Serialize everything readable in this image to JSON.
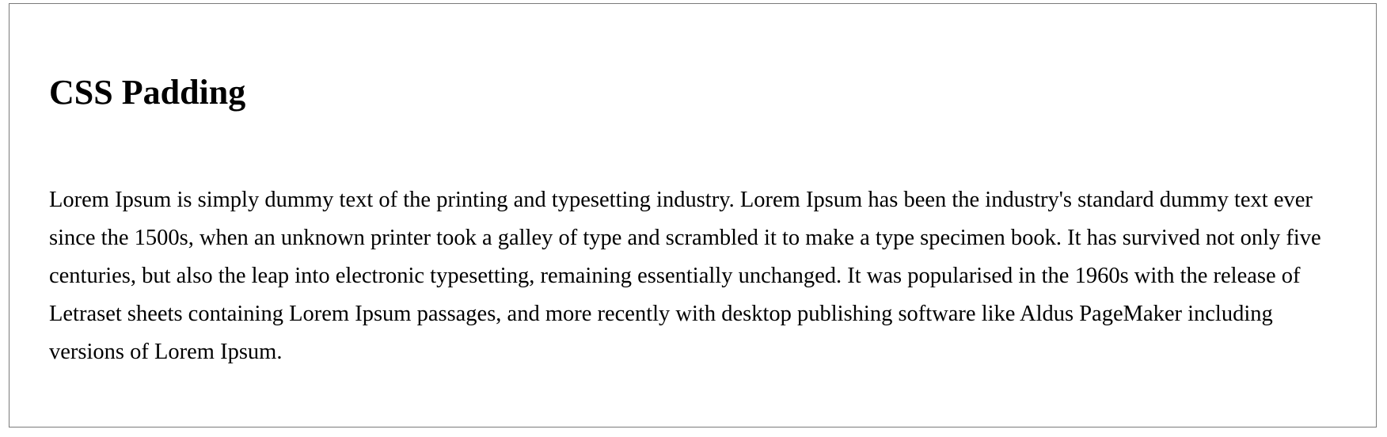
{
  "heading": "CSS Padding",
  "body_text": "Lorem Ipsum is simply dummy text of the printing and typesetting industry. Lorem Ipsum has been the industry's standard dummy text ever since the 1500s, when an unknown printer took a galley of type and scrambled it to make a type specimen book. It has survived not only five centuries, but also the leap into electronic typesetting, remaining essentially unchanged. It was popularised in the 1960s with the release of Letraset sheets containing Lorem Ipsum passages, and more recently with desktop publishing software like Aldus PageMaker including versions of Lorem Ipsum.",
  "colors": {
    "border": "#7a7a7a",
    "text": "#000000",
    "background": "#ffffff"
  }
}
